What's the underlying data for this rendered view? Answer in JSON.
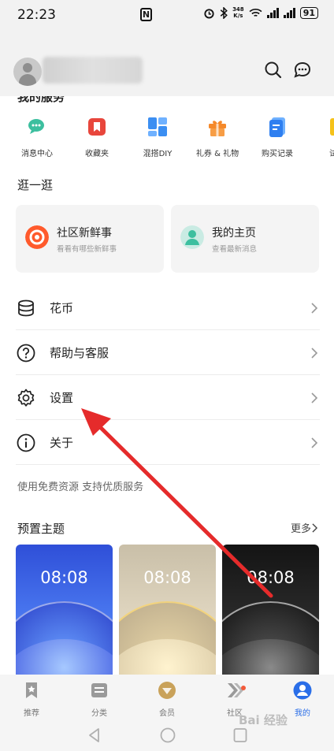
{
  "status_bar": {
    "time": "22:23",
    "net_speed_value": "348",
    "net_speed_unit": "K/s",
    "battery": "91"
  },
  "header": {
    "search_icon": "search-icon",
    "message_icon": "chat-bubble-icon"
  },
  "services": {
    "title": "我的服务",
    "items": [
      {
        "label": "消息中心",
        "icon": "message-center-icon",
        "color": "#3cbf9f"
      },
      {
        "label": "收藏夹",
        "icon": "bookmark-icon",
        "color": "#e8463c"
      },
      {
        "label": "混搭DIY",
        "icon": "diy-grid-icon",
        "color": "#3b8ef2"
      },
      {
        "label": "礼券 & 礼物",
        "icon": "gift-icon",
        "color": "#f5892a"
      },
      {
        "label": "购买记录",
        "icon": "purchase-record-icon",
        "color": "#2f7ff0"
      },
      {
        "label": "试用",
        "icon": "trial-icon",
        "color": "#f5c21a"
      }
    ]
  },
  "discover": {
    "title": "逛一逛",
    "cards": [
      {
        "title": "社区新鲜事",
        "subtitle": "看看有哪些新鲜事",
        "icon": "community-news-icon"
      },
      {
        "title": "我的主页",
        "subtitle": "查看最新消息",
        "icon": "profile-home-icon"
      }
    ]
  },
  "menu": [
    {
      "label": "花币",
      "icon": "coins-icon"
    },
    {
      "label": "帮助与客服",
      "icon": "help-icon"
    },
    {
      "label": "设置",
      "icon": "gear-icon"
    },
    {
      "label": "关于",
      "icon": "info-icon"
    }
  ],
  "tagline": "使用免费资源 支持优质服务",
  "themes": {
    "title": "预置主题",
    "more_label": "更多",
    "items": [
      {
        "time": "08:08",
        "style": "blue"
      },
      {
        "time": "08:08",
        "style": "gold"
      },
      {
        "time": "08:08",
        "style": "dark"
      }
    ]
  },
  "bottom_nav": [
    {
      "label": "推荐",
      "icon": "recommend-icon",
      "active": false
    },
    {
      "label": "分类",
      "icon": "category-icon",
      "active": false
    },
    {
      "label": "会员",
      "icon": "vip-icon",
      "active": false
    },
    {
      "label": "社区",
      "icon": "community-icon",
      "active": false
    },
    {
      "label": "我的",
      "icon": "user-icon",
      "active": true
    }
  ],
  "watermark": "Bai 经验",
  "colors": {
    "accent": "#2a6ee8",
    "arrow": "#e52b2b"
  }
}
